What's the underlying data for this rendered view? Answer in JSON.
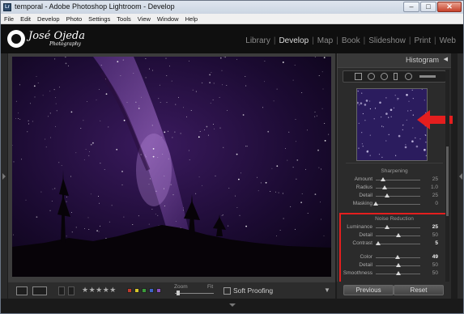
{
  "window": {
    "title": "temporal - Adobe Photoshop Lightroom - Develop",
    "app_icon_label": "Lr",
    "minimize_glyph": "–",
    "maximize_glyph": "□",
    "close_glyph": "✕"
  },
  "menubar": [
    "File",
    "Edit",
    "Develop",
    "Photo",
    "Settings",
    "Tools",
    "View",
    "Window",
    "Help"
  ],
  "identity_plate": {
    "name": "José Ojeda",
    "subtitle": "Photography"
  },
  "modules": [
    {
      "label": "Library",
      "active": false
    },
    {
      "label": "Develop",
      "active": true
    },
    {
      "label": "Map",
      "active": false
    },
    {
      "label": "Book",
      "active": false
    },
    {
      "label": "Slideshow",
      "active": false
    },
    {
      "label": "Print",
      "active": false
    },
    {
      "label": "Web",
      "active": false
    }
  ],
  "module_separator": "|",
  "panel": {
    "title": "Histogram",
    "collapse_glyph": "◀",
    "sharpening": {
      "title": "Sharpening",
      "rows": [
        {
          "label": "Amount",
          "value": "25",
          "level": 0.17
        },
        {
          "label": "Radius",
          "value": "1.0",
          "level": 0.2
        },
        {
          "label": "Detail",
          "value": "25",
          "level": 0.25
        },
        {
          "label": "Masking",
          "value": "0",
          "level": 0.0
        }
      ]
    },
    "noise_reduction": {
      "title": "Noise Reduction",
      "luminance": [
        {
          "label": "Luminance",
          "value": "25",
          "level": 0.25,
          "bright": true
        },
        {
          "label": "Detail",
          "value": "50",
          "level": 0.5,
          "bright": false
        },
        {
          "label": "Contrast",
          "value": "5",
          "level": 0.05,
          "bright": true
        }
      ],
      "color": [
        {
          "label": "Color",
          "value": "49",
          "level": 0.49,
          "bright": true
        },
        {
          "label": "Detail",
          "value": "50",
          "level": 0.5,
          "bright": false
        },
        {
          "label": "Smoothness",
          "value": "50",
          "level": 0.5,
          "bright": false
        }
      ]
    }
  },
  "toolbar": {
    "stars": "★★★★★",
    "zoom_label": "Zoom",
    "fit_label": "Fit",
    "soft_proofing_label": "Soft Proofing",
    "menu_glyph": "▼",
    "color_labels": [
      "#c0392b",
      "#d4c52a",
      "#3a9c3a",
      "#3d63c9",
      "#8a4fc0"
    ]
  },
  "buttons": {
    "previous": "Previous",
    "reset": "Reset"
  },
  "colors": {
    "highlight": "#e41e1e",
    "arrow": "#e41e1e"
  }
}
